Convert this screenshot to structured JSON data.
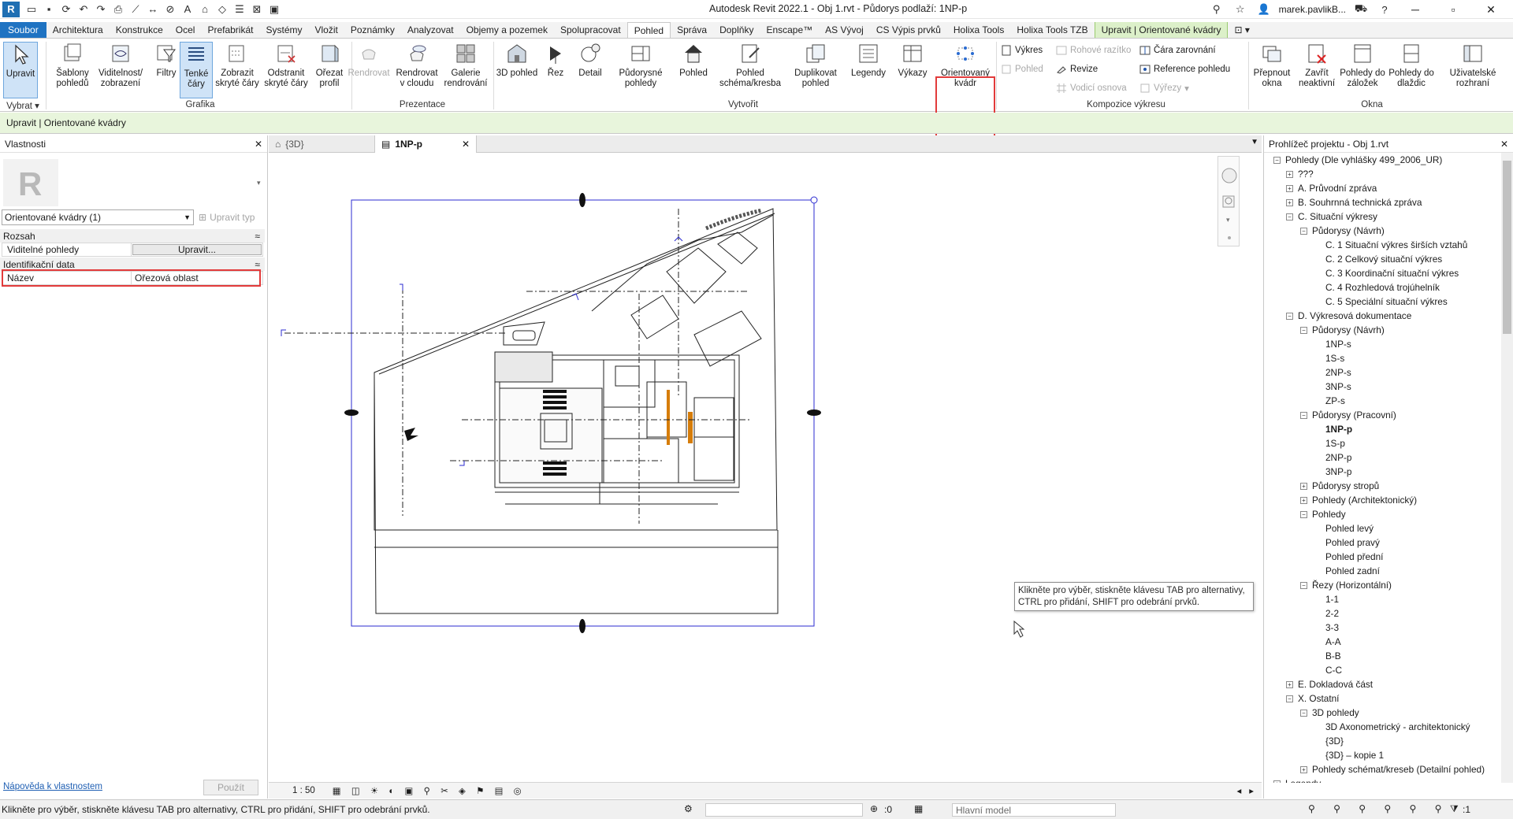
{
  "titlebar": {
    "title": "Autodesk Revit 2022.1 - Obj 1.rvt - Půdorys podlaží: 1NP-p",
    "user": "marek.pavlikB...",
    "app_logo_letter": "R"
  },
  "tabs": [
    {
      "label": "Soubor"
    },
    {
      "label": "Architektura"
    },
    {
      "label": "Konstrukce"
    },
    {
      "label": "Ocel"
    },
    {
      "label": "Prefabrikát"
    },
    {
      "label": "Systémy"
    },
    {
      "label": "Vložit"
    },
    {
      "label": "Poznámky"
    },
    {
      "label": "Analyzovat"
    },
    {
      "label": "Objemy a pozemek"
    },
    {
      "label": "Spolupracovat"
    },
    {
      "label": "Pohled"
    },
    {
      "label": "Správa"
    },
    {
      "label": "Doplňky"
    },
    {
      "label": "Enscape™"
    },
    {
      "label": "AS Vývoj"
    },
    {
      "label": "CS Výpis prvků"
    },
    {
      "label": "Holixa Tools"
    },
    {
      "label": "Holixa Tools TZB"
    },
    {
      "label": "Upravit | Orientované kvádry"
    }
  ],
  "ribbon": {
    "select": {
      "button": "Upravit",
      "panel": "Vybrat"
    },
    "grafika": {
      "panel": "Grafika",
      "buttons": [
        "Šablony pohledů",
        "Viditelnost/ zobrazení",
        "Filtry",
        "Tenké čáry",
        "Zobrazit skryté čáry",
        "Odstranit skryté čáry",
        "Ořezat profil"
      ]
    },
    "prezentace": {
      "panel": "Prezentace",
      "buttons": [
        "Rendrovat",
        "Rendrovat v cloudu",
        "Galerie rendrování"
      ]
    },
    "vytvorit": {
      "panel": "Vytvořit",
      "buttons": [
        "3D pohled",
        "Řez",
        "Detail",
        "Půdorysné pohledy",
        "Pohled",
        "Pohled schéma/kresba",
        "Duplikovat pohled",
        "Legendy",
        "Výkazy",
        "Orientovaný kvádr"
      ]
    },
    "kompozice": {
      "panel": "Kompozice výkresu",
      "small": [
        "Výkres",
        "Pohled",
        "Rohové razítko",
        "Revize",
        "Vodicí osnova",
        "Čára zarovnání",
        "Reference pohledu",
        "Výřezy"
      ]
    },
    "okna": {
      "panel": "Okna",
      "buttons": [
        "Přepnout okna",
        "Zavřít neaktivní",
        "Pohledy do záložek",
        "Pohledy do dlaždic",
        "Uživatelské rozhraní"
      ]
    }
  },
  "optbar": {
    "text": "Upravit | Orientované kvádry"
  },
  "properties": {
    "title": "Vlastnosti",
    "type_selector": "Orientované kvádry (1)",
    "edit_type": "Upravit typ",
    "section_rozsah": "Rozsah",
    "row_visible_views": {
      "key": "Viditelné pohledy",
      "button": "Upravit..."
    },
    "section_ident": "Identifikační data",
    "row_name": {
      "key": "Název",
      "value": "Ořezová oblast"
    },
    "help_link": "Nápověda k vlastnostem",
    "apply": "Použít"
  },
  "viewtabs": [
    {
      "label": "{3D}"
    },
    {
      "label": "1NP-p"
    }
  ],
  "viewcontrol": {
    "scale": "1 : 50"
  },
  "tooltip": {
    "text": "Klikněte pro výběr, stiskněte klávesu TAB pro alternativy, CTRL pro přidání, SHIFT pro odebrání prvků."
  },
  "browser": {
    "title": "Prohlížeč projektu - Obj 1.rvt",
    "nodes": [
      {
        "label": "Pohledy (Dle vyhlášky 499_2006_UR)",
        "level": 0,
        "toggle": "-"
      },
      {
        "label": "???",
        "level": 1,
        "toggle": "+"
      },
      {
        "label": "A. Průvodní zpráva",
        "level": 1,
        "toggle": "+"
      },
      {
        "label": "B. Souhrnná technická zpráva",
        "level": 1,
        "toggle": "+"
      },
      {
        "label": "C. Situační výkresy",
        "level": 1,
        "toggle": "-"
      },
      {
        "label": "Půdorysy (Návrh)",
        "level": 2,
        "toggle": "-"
      },
      {
        "label": "C. 1 Situační výkres širších vztahů",
        "level": 3,
        "toggle": ""
      },
      {
        "label": "C. 2 Celkový situační výkres",
        "level": 3,
        "toggle": ""
      },
      {
        "label": "C. 3 Koordinační situační výkres",
        "level": 3,
        "toggle": ""
      },
      {
        "label": "C. 4 Rozhledová trojúhelník",
        "level": 3,
        "toggle": ""
      },
      {
        "label": "C. 5 Speciální situační výkres",
        "level": 3,
        "toggle": ""
      },
      {
        "label": "D. Výkresová dokumentace",
        "level": 1,
        "toggle": "-"
      },
      {
        "label": "Půdorysy (Návrh)",
        "level": 2,
        "toggle": "-"
      },
      {
        "label": "1NP-s",
        "level": 3,
        "toggle": ""
      },
      {
        "label": "1S-s",
        "level": 3,
        "toggle": ""
      },
      {
        "label": "2NP-s",
        "level": 3,
        "toggle": ""
      },
      {
        "label": "3NP-s",
        "level": 3,
        "toggle": ""
      },
      {
        "label": "ZP-s",
        "level": 3,
        "toggle": ""
      },
      {
        "label": "Půdorysy (Pracovní)",
        "level": 2,
        "toggle": "-"
      },
      {
        "label": "1NP-p",
        "level": 3,
        "toggle": "",
        "bold": true
      },
      {
        "label": "1S-p",
        "level": 3,
        "toggle": ""
      },
      {
        "label": "2NP-p",
        "level": 3,
        "toggle": ""
      },
      {
        "label": "3NP-p",
        "level": 3,
        "toggle": ""
      },
      {
        "label": "Půdorysy stropů",
        "level": 2,
        "toggle": "+"
      },
      {
        "label": "Pohledy (Architektonický)",
        "level": 2,
        "toggle": "+"
      },
      {
        "label": "Pohledy",
        "level": 2,
        "toggle": "-"
      },
      {
        "label": "Pohled levý",
        "level": 3,
        "toggle": ""
      },
      {
        "label": "Pohled pravý",
        "level": 3,
        "toggle": ""
      },
      {
        "label": "Pohled přední",
        "level": 3,
        "toggle": ""
      },
      {
        "label": "Pohled zadní",
        "level": 3,
        "toggle": ""
      },
      {
        "label": "Řezy (Horizontální)",
        "level": 2,
        "toggle": "-"
      },
      {
        "label": "1-1",
        "level": 3,
        "toggle": ""
      },
      {
        "label": "2-2",
        "level": 3,
        "toggle": ""
      },
      {
        "label": "3-3",
        "level": 3,
        "toggle": ""
      },
      {
        "label": "A-A",
        "level": 3,
        "toggle": ""
      },
      {
        "label": "B-B",
        "level": 3,
        "toggle": ""
      },
      {
        "label": "C-C",
        "level": 3,
        "toggle": ""
      },
      {
        "label": "E. Dokladová část",
        "level": 1,
        "toggle": "+"
      },
      {
        "label": "X. Ostatní",
        "level": 1,
        "toggle": "-"
      },
      {
        "label": "3D pohledy",
        "level": 2,
        "toggle": "-"
      },
      {
        "label": "3D Axonometrický - architektonický",
        "level": 3,
        "toggle": ""
      },
      {
        "label": "{3D}",
        "level": 3,
        "toggle": ""
      },
      {
        "label": "{3D} – kopie 1",
        "level": 3,
        "toggle": ""
      },
      {
        "label": "Pohledy schémat/kreseb (Detailní pohled)",
        "level": 2,
        "toggle": "+"
      },
      {
        "label": "Legendy",
        "level": 0,
        "toggle": "+"
      }
    ]
  },
  "statusbar": {
    "text": "Klikněte pro výběr, stiskněte klávesu TAB pro alternativy, CTRL pro přidání, SHIFT pro odebrání prvků.",
    "zero": ":0",
    "model": "Hlavní model",
    "filter_count": ":1"
  },
  "colors": {
    "file_tab": "#1f73c2",
    "contextual_tab": "#dcf0c9",
    "highlight_red": "#e23b3b",
    "crop_blue": "#2b2bd0"
  }
}
